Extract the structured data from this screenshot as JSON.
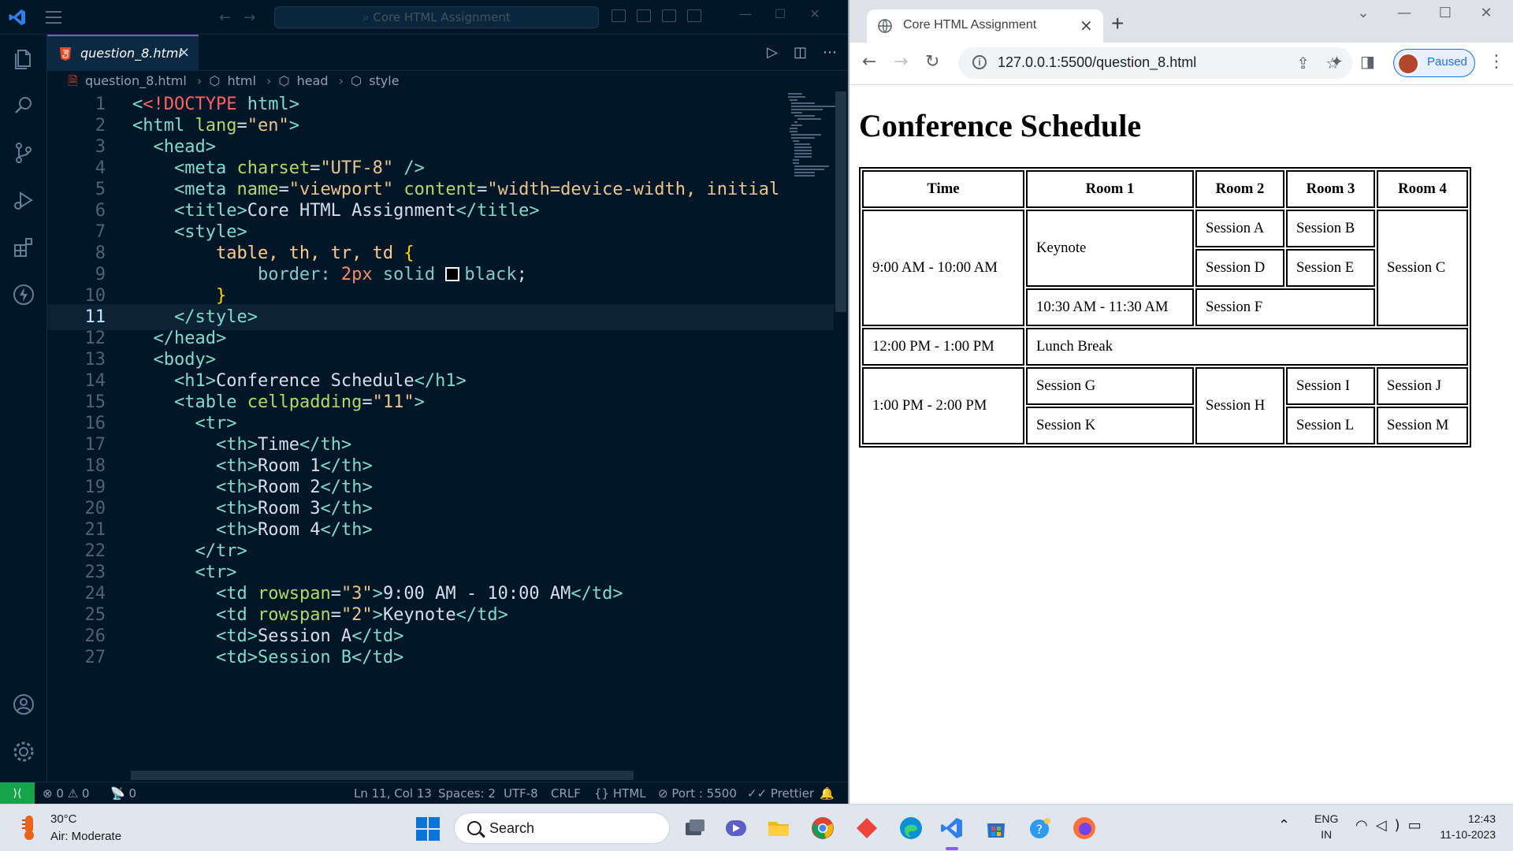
{
  "vscode": {
    "search_placeholder": "Core HTML Assignment",
    "tab": {
      "label": "question_8.html",
      "close": "×"
    },
    "breadcrumb": [
      "question_8.html",
      "html",
      "head",
      "style"
    ],
    "lines": [
      {
        "n": "1"
      },
      {
        "n": "2"
      },
      {
        "n": "3"
      },
      {
        "n": "4"
      },
      {
        "n": "5"
      },
      {
        "n": "6"
      },
      {
        "n": "7"
      },
      {
        "n": "8"
      },
      {
        "n": "9"
      },
      {
        "n": "10"
      },
      {
        "n": "11"
      },
      {
        "n": "12"
      },
      {
        "n": "13"
      },
      {
        "n": "14"
      },
      {
        "n": "15"
      },
      {
        "n": "16"
      },
      {
        "n": "17"
      },
      {
        "n": "18"
      },
      {
        "n": "19"
      },
      {
        "n": "20"
      },
      {
        "n": "21"
      },
      {
        "n": "22"
      },
      {
        "n": "23"
      },
      {
        "n": "24"
      },
      {
        "n": "25"
      },
      {
        "n": "26"
      },
      {
        "n": "27"
      }
    ],
    "code": {
      "doctype": "<!DOCTYPE",
      "html_kw": "html",
      "lang_val": "\"en\"",
      "charset_val": "\"UTF-8\"",
      "viewport_val": "\"viewport\"",
      "content_val": "\"width=device-width, initial",
      "title_text": "Core HTML Assignment",
      "selector": "table, th, tr, td",
      "prop": "border:",
      "val_num": "2px",
      "val_kw": "solid",
      "val_color": "black",
      "h1_text": "Conference Schedule",
      "cellpadding_val": "\"11\"",
      "th_time": "Time",
      "th_room1": "Room 1",
      "th_room2": "Room 2",
      "th_room3": "Room 3",
      "th_room4": "Room 4",
      "rowspan3": "\"3\"",
      "td_time1": "9:00 AM - 10:00 AM",
      "rowspan2": "\"2\"",
      "td_keynote": "Keynote",
      "td_sessionA": "Session A",
      "td_sessionB_partial": "<td>Session B</td>"
    },
    "status": {
      "errors": "0",
      "warnings": "0",
      "ports": "0",
      "position": "Ln 11, Col 13",
      "spaces": "Spaces: 2",
      "encoding": "UTF-8",
      "eol": "CRLF",
      "language": "HTML",
      "port": "Port : 5500",
      "formatter": "Prettier"
    }
  },
  "browser": {
    "tab_title": "Core HTML Assignment",
    "url": "127.0.0.1:5500/question_8.html",
    "profile_label": "Paused",
    "page": {
      "heading": "Conference Schedule",
      "headers": [
        "Time",
        "Room 1",
        "Room 2",
        "Room 3",
        "Room 4"
      ],
      "cells": {
        "time1": "9:00 AM - 10:00 AM",
        "keynote": "Keynote",
        "sA": "Session A",
        "sB": "Session B",
        "sC": "Session C",
        "sD": "Session D",
        "sE": "Session E",
        "time_1030": "10:30 AM - 11:30 AM",
        "sF": "Session F",
        "time2": "12:00 PM - 1:00 PM",
        "lunch": "Lunch Break",
        "time3": "1:00 PM - 2:00 PM",
        "sG": "Session G",
        "sH": "Session H",
        "sI": "Session I",
        "sJ": "Session J",
        "sK": "Session K",
        "sL": "Session L",
        "sM": "Session M"
      }
    }
  },
  "taskbar": {
    "weather_temp": "30°C",
    "weather_desc": "Air: Moderate",
    "search_label": "Search",
    "lang_top": "ENG",
    "lang_bottom": "IN",
    "time": "12:43",
    "date": "11-10-2023"
  }
}
